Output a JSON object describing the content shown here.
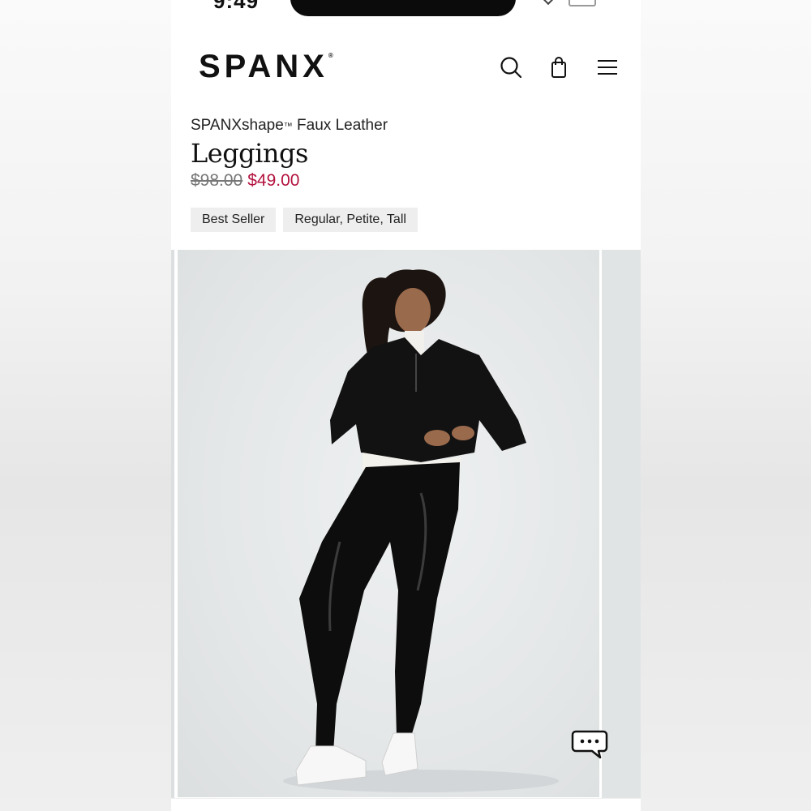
{
  "brand": {
    "logo_text": "SPANX",
    "logo_mark": "®"
  },
  "header": {
    "icons": [
      "search-icon",
      "shopping-bag-icon",
      "menu-icon"
    ]
  },
  "product": {
    "subtitle_prefix": "SPANXshape",
    "subtitle_tm": "™",
    "subtitle_suffix": " Faux Leather",
    "title": "Leggings",
    "original_price": "$98.00",
    "sale_price": "$49.00",
    "badges": [
      "Best Seller",
      "Regular, Petite, Tall"
    ]
  },
  "colors": {
    "sale_price": "#b3123f",
    "badge_bg": "#eeeeee",
    "text": "#111111"
  },
  "chat": {
    "icon": "chat-bubble-icon"
  }
}
